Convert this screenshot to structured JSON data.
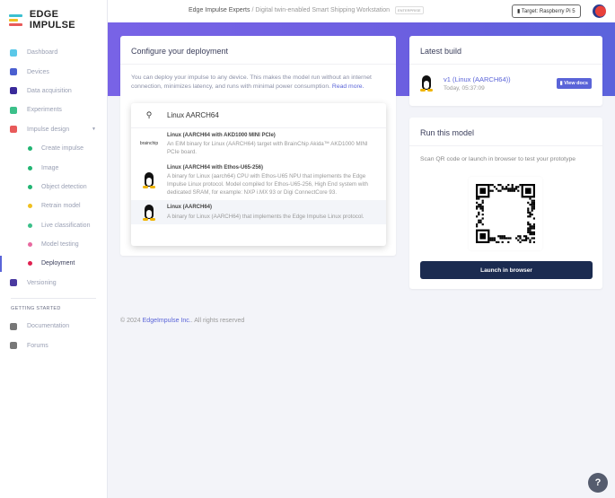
{
  "app": {
    "name": "EDGE IMPULSE"
  },
  "header": {
    "org": "Edge Impulse Experts",
    "separator": "/",
    "project": "Digital twin-enabled Smart Shipping Workstation",
    "badge": "ENTERPRISE",
    "target": "Target: Raspberry Pi 5"
  },
  "sidebar": {
    "items": [
      {
        "label": "Dashboard",
        "color": "#5bc8e8"
      },
      {
        "label": "Devices",
        "color": "#4a5fd0"
      },
      {
        "label": "Data acquisition",
        "color": "#3a2a9a"
      },
      {
        "label": "Experiments",
        "color": "#3cc08a"
      },
      {
        "label": "Impulse design",
        "color": "#e85a5a"
      },
      {
        "label": "Create impulse",
        "color": "#22b573"
      },
      {
        "label": "Image",
        "color": "#22b573"
      },
      {
        "label": "Object detection",
        "color": "#22b573"
      },
      {
        "label": "Retrain model",
        "color": "#f0c020"
      },
      {
        "label": "Live classification",
        "color": "#3cc08a"
      },
      {
        "label": "Model testing",
        "color": "#e86aa0"
      },
      {
        "label": "Deployment",
        "color": "#e02050"
      },
      {
        "label": "Versioning",
        "color": "#4a3aa0"
      }
    ],
    "section": "GETTING STARTED",
    "extra": [
      {
        "label": "Documentation"
      },
      {
        "label": "Forums"
      }
    ]
  },
  "configure": {
    "title": "Configure your deployment",
    "description": "You can deploy your impulse to any device. This makes the model run without an internet connection, minimizes latency, and runs with minimal power consumption.",
    "read_more": "Read more.",
    "search_value": "Linux AARCH64",
    "options": [
      {
        "title": "Linux (AARCH64 with AKD1000 MINI PCIe)",
        "desc": "An EIM binary for Linux (AARCH64) target with BrainChip Akida™ AKD1000 MINI PCIe board.",
        "logo": "brainchip"
      },
      {
        "title": "Linux (AARCH64 with Ethos-U65-256)",
        "desc": "A binary for Linux (aarch64) CPU with Ethos-U65 NPU that implements the Edge Impulse Linux protocol. Model compiled for Ethos-U65-256, High End system with dedicated SRAM, for example: NXP i.MX 93 or Digi ConnectCore 93.",
        "logo": "linux"
      },
      {
        "title": "Linux (AARCH64)",
        "desc": "A binary for Linux (AARCH64) that implements the Edge Impulse Linux protocol.",
        "logo": "linux"
      }
    ]
  },
  "latest": {
    "title": "Latest build",
    "name": "v1 (Linux (AARCH64))",
    "time": "Today, 05:37:09",
    "docs": "View docs"
  },
  "run": {
    "title": "Run this model",
    "desc": "Scan QR code or launch in browser to test your prototype",
    "launch": "Launch in browser"
  },
  "footer": {
    "copy": "© 2024",
    "company": "EdgeImpulse Inc.",
    "rights": "All rights reserved"
  },
  "help": "?"
}
